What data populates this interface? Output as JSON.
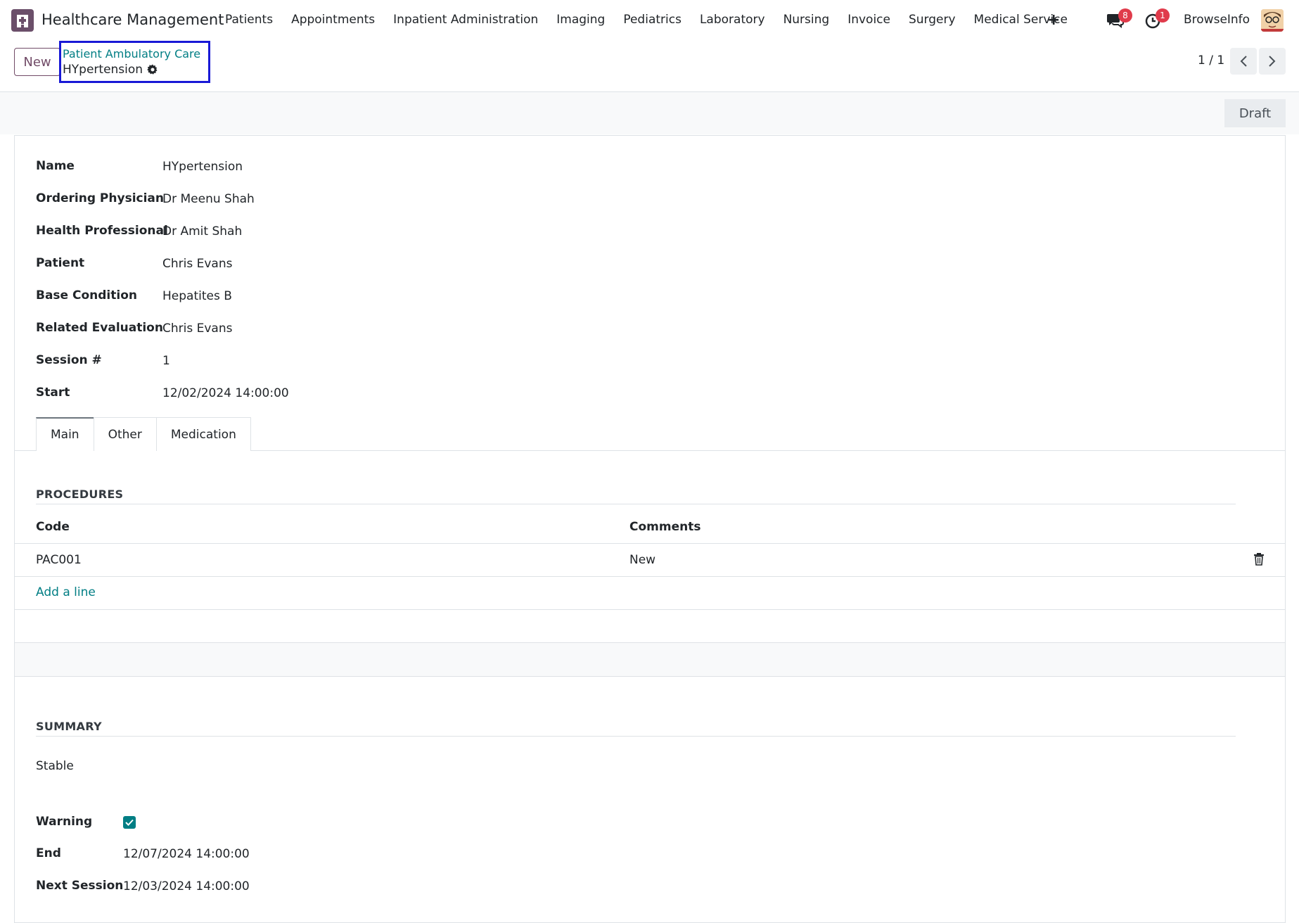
{
  "navbar": {
    "app_title": "Healthcare Management",
    "menu": [
      "Patients",
      "Appointments",
      "Inpatient Administration",
      "Imaging",
      "Pediatrics",
      "Laboratory",
      "Nursing",
      "Invoice",
      "Surgery",
      "Medical Service"
    ],
    "plus": "+",
    "messages_count": "8",
    "activities_count": "1",
    "user": "BrowseInfo"
  },
  "control": {
    "new_label": "New",
    "breadcrumb_parent": "Patient Ambulatory Care",
    "breadcrumb_current": "HYpertension",
    "pager": "1 / 1"
  },
  "status": {
    "draft": "Draft"
  },
  "fields": {
    "name": {
      "label": "Name",
      "value": "HYpertension"
    },
    "ordering_physician": {
      "label": "Ordering Physician",
      "value": "Dr Meenu Shah"
    },
    "health_professional": {
      "label": "Health Professional",
      "value": "Dr Amit Shah"
    },
    "patient": {
      "label": "Patient",
      "value": "Chris Evans"
    },
    "base_condition": {
      "label": "Base Condition",
      "value": "Hepatites B"
    },
    "related_evaluation": {
      "label": "Related Evaluation",
      "value": "Chris Evans"
    },
    "session": {
      "label": "Session #",
      "value": "1"
    },
    "start": {
      "label": "Start",
      "value": "12/02/2024 14:00:00"
    }
  },
  "tabs": [
    "Main",
    "Other",
    "Medication"
  ],
  "procedures": {
    "title": "PROCEDURES",
    "columns": [
      "Code",
      "Comments"
    ],
    "rows": [
      {
        "code": "PAC001",
        "comments": "New"
      }
    ],
    "add_line": "Add a line"
  },
  "summary": {
    "title": "SUMMARY",
    "text": "Stable",
    "warning_label": "Warning",
    "warning_checked": true,
    "end_label": "End",
    "end_value": "12/07/2024 14:00:00",
    "next_session_label": "Next Session",
    "next_session_value": "12/03/2024 14:00:00"
  },
  "colors": {
    "brand": "#714b67",
    "accent": "#017e84",
    "badge": "#e03b4b",
    "highlight_box": "#1919d6"
  }
}
